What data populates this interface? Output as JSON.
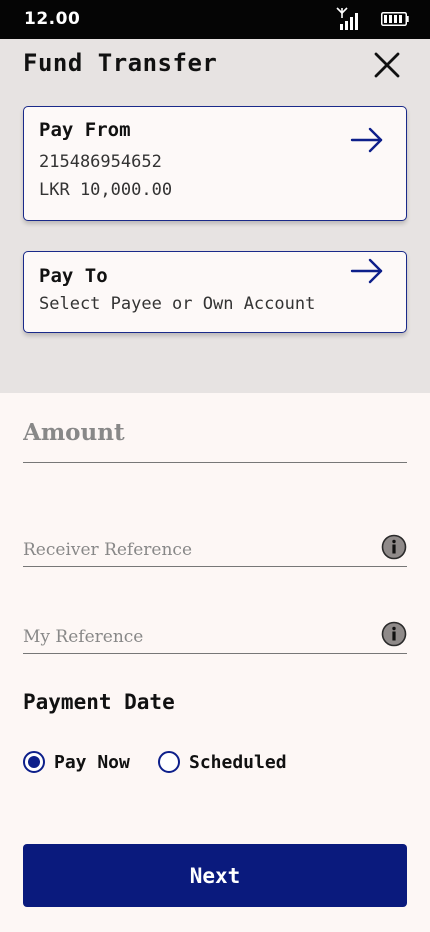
{
  "status_bar": {
    "time": "12.00",
    "signal_icon": "signal-icon",
    "battery_icon": "battery-icon"
  },
  "header": {
    "title": "Fund Transfer",
    "close_icon": "close-icon"
  },
  "pay_from": {
    "heading": "Pay From",
    "account_number": "215486954652",
    "balance": "LKR 10,000.00",
    "arrow_icon": "arrow-right-icon"
  },
  "pay_to": {
    "heading": "Pay To",
    "hint": "Select Payee or Own Account",
    "arrow_icon": "arrow-right-icon"
  },
  "form": {
    "amount": {
      "placeholder": "Amount",
      "value": ""
    },
    "receiver_reference": {
      "placeholder": "Receiver Reference",
      "value": "",
      "info_icon": "info-icon"
    },
    "my_reference": {
      "placeholder": "My Reference",
      "value": "",
      "info_icon": "info-icon"
    }
  },
  "payment_date": {
    "heading": "Payment Date",
    "options": [
      {
        "label": "Pay Now",
        "selected": true
      },
      {
        "label": "Scheduled",
        "selected": false
      }
    ]
  },
  "next_button": {
    "label": "Next"
  },
  "colors": {
    "accent": "#0a1a7d",
    "card_border": "#1a2a8a",
    "top_background": "#e7e3e2",
    "page_background": "#fdf7f5",
    "status_bar": "#050505"
  }
}
